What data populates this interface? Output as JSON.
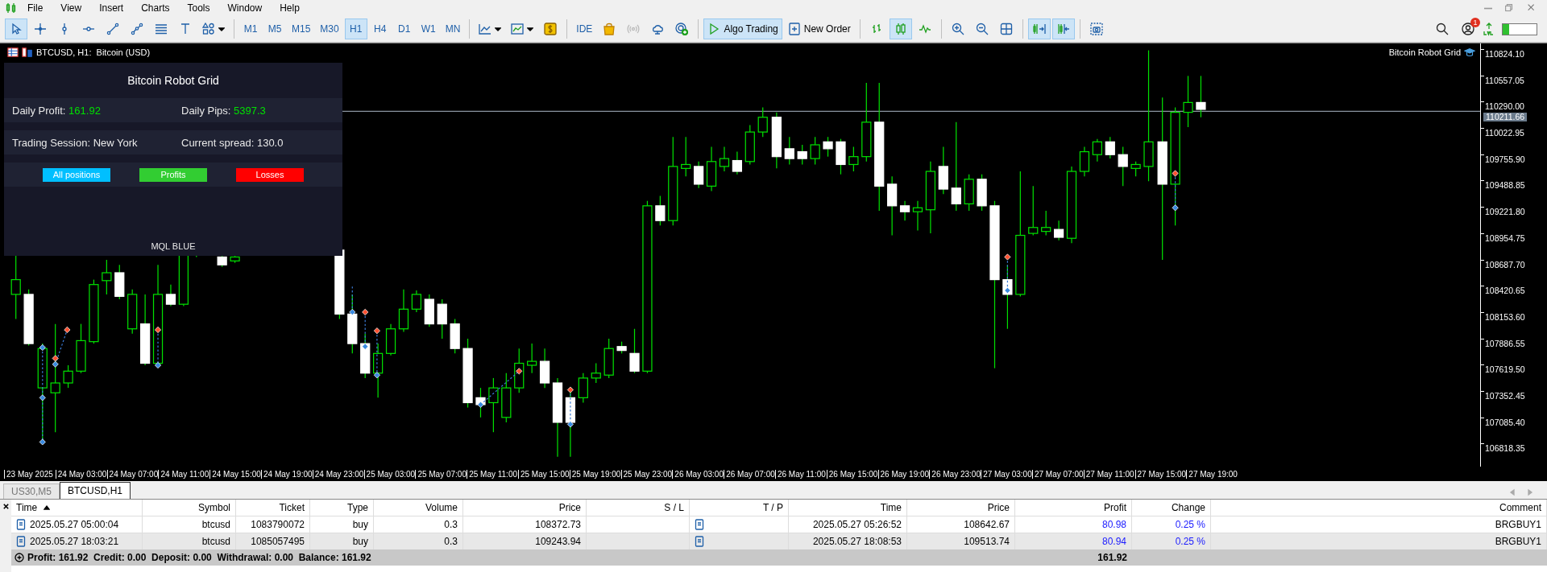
{
  "menu": [
    "File",
    "View",
    "Insert",
    "Charts",
    "Tools",
    "Window",
    "Help"
  ],
  "toolbar": {
    "draw_tools": [
      {
        "selected": true
      },
      {
        "selected": false
      },
      {
        "selected": false
      },
      {
        "selected": false
      },
      {
        "selected": false
      },
      {
        "selected": false
      },
      {
        "selected": false
      },
      {
        "selected": false
      },
      {
        "selected": false
      }
    ],
    "timeframes": [
      {
        "label": "M1",
        "selected": false
      },
      {
        "label": "M5",
        "selected": false
      },
      {
        "label": "M15",
        "selected": false
      },
      {
        "label": "M30",
        "selected": false
      },
      {
        "label": "H1",
        "selected": true
      },
      {
        "label": "H4",
        "selected": false
      },
      {
        "label": "D1",
        "selected": false
      },
      {
        "label": "W1",
        "selected": false
      },
      {
        "label": "MN",
        "selected": false
      }
    ],
    "ide": "IDE",
    "algo_trading": {
      "label": "Algo Trading",
      "on": true
    },
    "new_order": "New Order",
    "chart_types": [
      {
        "selected": false
      },
      {
        "selected": true
      },
      {
        "selected": false
      }
    ],
    "scroll_toggles": [
      {
        "selected": true
      },
      {
        "selected": true
      }
    ],
    "notifications": "1"
  },
  "chart": {
    "title": "BTCUSD, H1:  Bitcoin (USD)",
    "expert": "Bitcoin Robot Grid",
    "price_labels": [
      "110824.10",
      "110557.05",
      "110290.00",
      "110022.95",
      "109755.90",
      "109488.85",
      "109221.80",
      "108954.75",
      "108687.70",
      "108420.65",
      "108153.60",
      "107886.55",
      "107619.50",
      "107352.45",
      "107085.40",
      "106818.35"
    ],
    "current_price": "110211.66",
    "time_labels": [
      "23 May 2025",
      "24 May 03:00",
      "24 May 07:00",
      "24 May 11:00",
      "24 May 15:00",
      "24 May 19:00",
      "24 May 23:00",
      "25 May 03:00",
      "25 May 07:00",
      "25 May 11:00",
      "25 May 15:00",
      "25 May 19:00",
      "25 May 23:00",
      "26 May 03:00",
      "26 May 07:00",
      "26 May 11:00",
      "26 May 15:00",
      "26 May 19:00",
      "26 May 23:00",
      "27 May 03:00",
      "27 May 07:00",
      "27 May 11:00",
      "27 May 15:00",
      "27 May 19:00"
    ]
  },
  "panel": {
    "title": "Bitcoin Robot Grid",
    "stats": [
      {
        "label": "Daily Profit:",
        "value": "161.92"
      },
      {
        "label": "Daily Pips:",
        "value": "5397.3"
      },
      {
        "label": "Trading Session: New York"
      },
      {
        "label": "Current spread: 130.0"
      }
    ],
    "buttons": [
      {
        "label": "All positions",
        "color": "#00bfff"
      },
      {
        "label": "Profits",
        "color": "#32cd32"
      },
      {
        "label": "Losses",
        "color": "#ff0000"
      }
    ],
    "footer": "MQL BLUE"
  },
  "tabs": [
    {
      "label": "US30,M5",
      "selected": false
    },
    {
      "label": "BTCUSD,H1",
      "selected": true
    }
  ],
  "positions": {
    "columns": [
      {
        "label": "Time",
        "sorted": true
      },
      {
        "label": "Symbol",
        "sorted": false
      },
      {
        "label": "Ticket",
        "sorted": false
      },
      {
        "label": "Type",
        "sorted": false
      },
      {
        "label": "Volume",
        "sorted": false
      },
      {
        "label": "Price",
        "sorted": false
      },
      {
        "label": "S / L",
        "sorted": false
      },
      {
        "label": "T / P",
        "sorted": false
      },
      {
        "label": "Time",
        "sorted": false
      },
      {
        "label": "Price",
        "sorted": false
      },
      {
        "label": "Profit",
        "sorted": false
      },
      {
        "label": "Change",
        "sorted": false
      },
      {
        "label": "Comment",
        "sorted": false
      }
    ],
    "rows": [
      {
        "selected": false,
        "cells": [
          "2025.05.27 05:00:04",
          "btcusd",
          "1083790072",
          "buy",
          "0.3",
          "108372.73",
          "",
          "",
          "2025.05.27 05:26:52",
          "108642.67",
          "80.98",
          "0.25 %",
          "BRGBUY1"
        ]
      },
      {
        "selected": true,
        "cells": [
          "2025.05.27 18:03:21",
          "btcusd",
          "1085057495",
          "buy",
          "0.3",
          "109243.94",
          "",
          "",
          "2025.05.27 18:08:53",
          "109513.74",
          "80.94",
          "0.25 %",
          "BRGBUY1"
        ]
      }
    ],
    "summary": "Profit: 161.92  Credit: 0.00  Deposit: 0.00  Withdrawal: 0.00  Balance: 161.92",
    "profit_total": "161.92"
  }
}
